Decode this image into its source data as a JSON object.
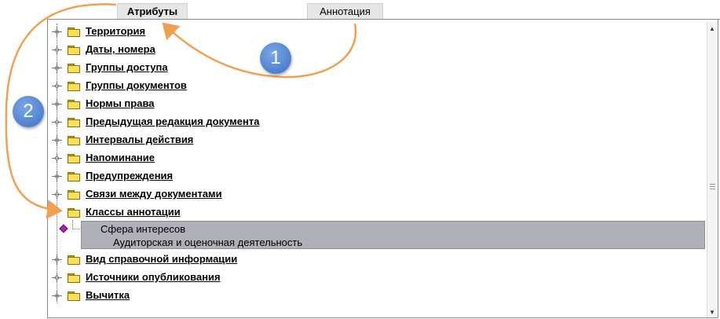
{
  "tabs": [
    {
      "label": "Атрибуты",
      "active": true
    },
    {
      "label": "Аннотация",
      "active": false
    }
  ],
  "tree": [
    {
      "label": "Территория"
    },
    {
      "label": "Даты, номера"
    },
    {
      "label": "Группы доступа"
    },
    {
      "label": "Группы документов"
    },
    {
      "label": "Нормы права"
    },
    {
      "label": "Предыдущая редакция документа"
    },
    {
      "label": "Интервалы действия"
    },
    {
      "label": "Напоминание"
    },
    {
      "label": "Предупреждения"
    },
    {
      "label": "Связи между документами"
    },
    {
      "label": "Классы аннотации",
      "expanded": true
    },
    {
      "label": "Вид справочной информации"
    },
    {
      "label": "Источники опубликования"
    },
    {
      "label": "Вычитка"
    }
  ],
  "selected_child": {
    "line1": "Сфера интересов",
    "line2": "Аудиторская и оценочная деятельность"
  },
  "callouts": [
    "1",
    "2"
  ],
  "colors": {
    "callout": "#3b6fc4",
    "arrow": "#f0a050",
    "selection": "#b0b0b8"
  }
}
